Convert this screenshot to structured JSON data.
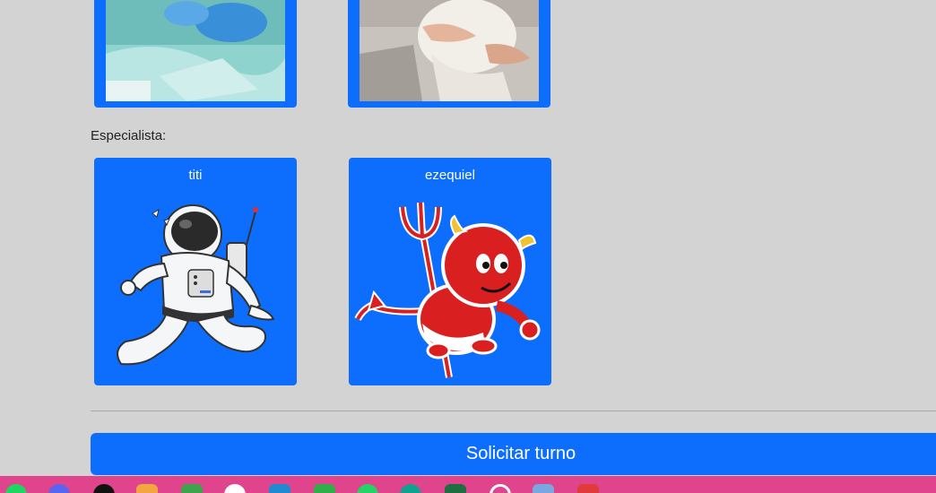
{
  "specialist_section": {
    "label": "Especialista:",
    "specialists": [
      {
        "name": "titi",
        "image_icon": "astronaut-icon"
      },
      {
        "name": "ezequiel",
        "image_icon": "red-devil-icon"
      }
    ]
  },
  "specialty_photos": [
    {
      "image_icon": "dental-photo"
    },
    {
      "image_icon": "knee-bandage-photo"
    }
  ],
  "submit": {
    "label": "Solicitar turno"
  },
  "taskbar": {
    "apps": [
      "spotify-icon",
      "discord-icon",
      "github-icon",
      "app-orange-icon",
      "minecraft-icon",
      "slack-icon",
      "vscode-icon",
      "app-green-icon",
      "whatsapp-icon",
      "edge-icon",
      "excel-icon",
      "settings-icon",
      "app-window-icon",
      "app-red-icon"
    ]
  },
  "colors": {
    "accent": "#0d6efd",
    "background": "#d3d3d3",
    "taskbar": "#e0448d"
  }
}
